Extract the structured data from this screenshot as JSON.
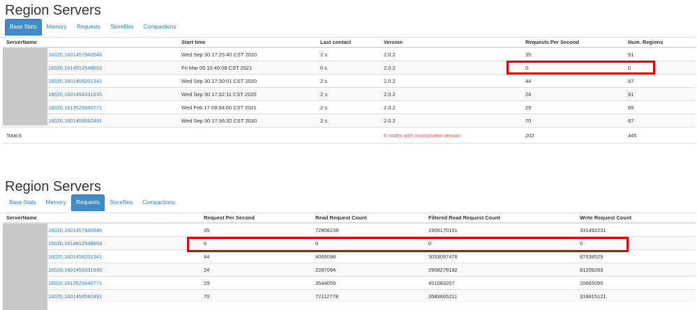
{
  "panel1": {
    "title": "Region Servers",
    "tabs": [
      "Base Stats",
      "Memory",
      "Requests",
      "Storefiles",
      "Compactions"
    ],
    "active_tab": "Base Stats",
    "columns": [
      "ServerName",
      "Start time",
      "Last contact",
      "Version",
      "Requests Per Second",
      "Num. Regions"
    ],
    "rows": [
      [
        "16020,1601457940546",
        "Wed Sep 30 17:25:40 CST 2020",
        "2 s",
        "2.0.2",
        "35",
        "91"
      ],
      [
        "16020,1614912548653",
        "Fri Mar 05 10:49:08 CST 2021",
        "0 s",
        "2.0.2",
        "0",
        "0"
      ],
      [
        "16020,1601458201341",
        "Wed Sep 30 17:30:01 CST 2020",
        "2 s",
        "2.0.2",
        "44",
        "87"
      ],
      [
        "16020,1601458331935",
        "Wed Sep 30 17:32:11 CST 2020",
        "2 s",
        "2.0.2",
        "24",
        "91"
      ],
      [
        "16020,1613525640771",
        "Wed Feb 17 09:34:00 CST 2021",
        "2 s",
        "2.0.2",
        "29",
        "89"
      ],
      [
        "16020,1601458592491",
        "Wed Sep 30 17:36:32 CST 2020",
        "2 s",
        "2.0.2",
        "70",
        "87"
      ]
    ],
    "total": {
      "label": "Total:6",
      "version_note": "6 nodes with inconsistent version",
      "requests": "202",
      "regions": "445"
    }
  },
  "panel2": {
    "title": "Region Servers",
    "tabs": [
      "Base Stats",
      "Memory",
      "Requests",
      "Storefiles",
      "Compactions"
    ],
    "active_tab": "Requests",
    "columns": [
      "ServerName",
      "Request Per Second",
      "Read Request Count",
      "Filtered Read Request Count",
      "Write Request Count"
    ],
    "rows": [
      [
        "16020,1601457940546",
        "35",
        "72808238",
        "1906170151",
        "331492231"
      ],
      [
        "16020,1614912548653",
        "0",
        "0",
        "0",
        "0"
      ],
      [
        "16020,1601458201341",
        "44",
        "4066098",
        "3053097478",
        "87638529"
      ],
      [
        "16020,1601458331935",
        "24",
        "2287094",
        "2908276192",
        "81209263"
      ],
      [
        "16020,1613525640771",
        "29",
        "3544059",
        "451083207",
        "20665090"
      ],
      [
        "16020,1601458592491",
        "70",
        "72112778",
        "3589665211",
        "316815121"
      ]
    ]
  },
  "colors": {
    "link": "#337ab7",
    "active_tab": "#428bca",
    "warning": "#d9534f",
    "highlight_box": "#e00000",
    "redaction": "#c8c8c8"
  }
}
